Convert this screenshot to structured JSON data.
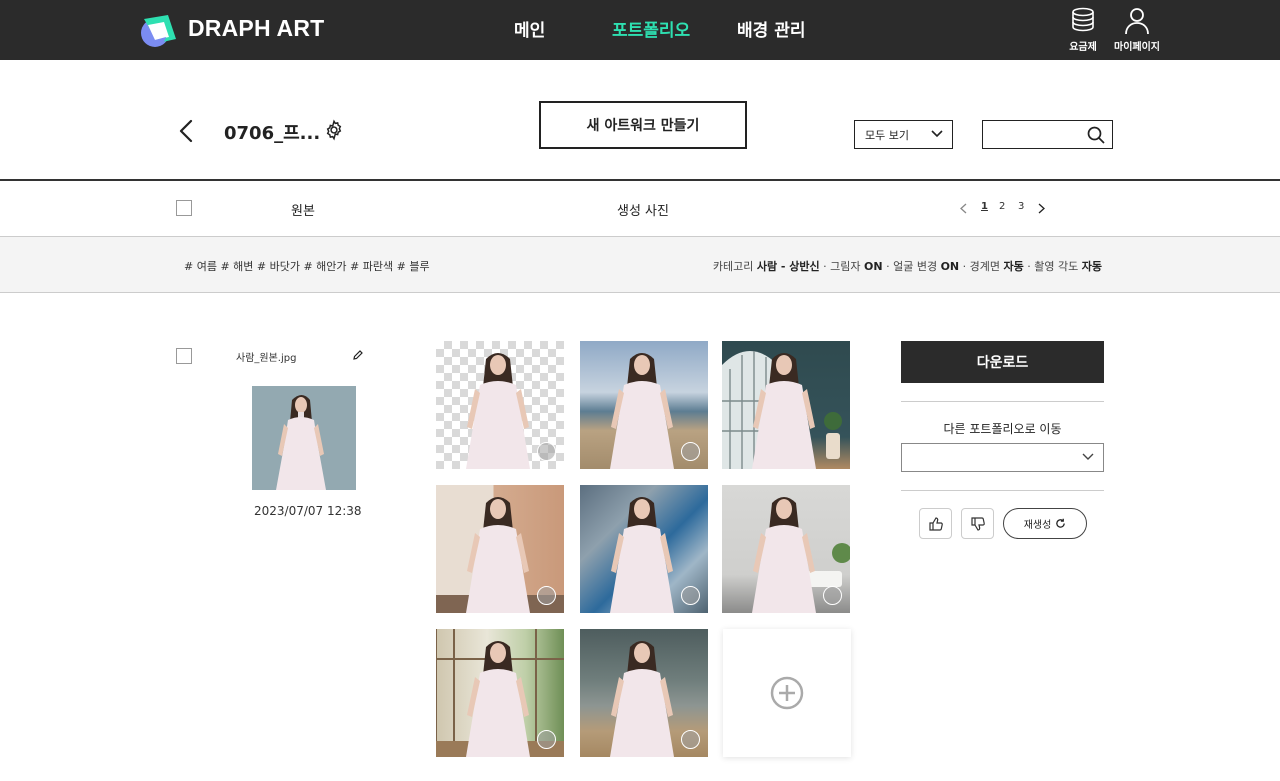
{
  "topbar": {
    "brand": "DRAPH ART",
    "nav": [
      "메인",
      "포트폴리오",
      "배경 관리"
    ],
    "active_nav": "포트폴리오",
    "accent_color": "#2ee0b1",
    "icons": [
      {
        "icon": "coins-icon",
        "label": "요금제"
      },
      {
        "icon": "user-icon",
        "label": "마이페이지"
      }
    ]
  },
  "header": {
    "portfolio_title": "0706_프...",
    "new_artwork_label": "새 아트워크 만들기",
    "filter_value": "모두 보기",
    "search_value": ""
  },
  "columns": {
    "original": "원본",
    "generated": "생성 사진",
    "pages": [
      "1",
      "2",
      "3"
    ],
    "current_page": "1"
  },
  "tags": "# 여름 # 해변 # 바닷가 # 해안가 # 파란색 # 블루",
  "meta": {
    "category_label": "카테고리",
    "category_value": "사람 - 상반신",
    "shadow_label": "그림자",
    "shadow_value": "ON",
    "face_label": "얼굴 변경",
    "face_value": "ON",
    "border_label": "경계면",
    "border_value": "자동",
    "angle_label": "촬영 각도",
    "angle_value": "자동"
  },
  "original": {
    "filename": "사람_원본.jpg",
    "date": "2023/07/07 12:38"
  },
  "generated_images": [
    {
      "background": "transparent-checker"
    },
    {
      "background": "beach-sky"
    },
    {
      "background": "dark-teal-room-arched-window"
    },
    {
      "background": "beige-arch-wall"
    },
    {
      "background": "blurred-blue-coast"
    },
    {
      "background": "white-bathroom"
    },
    {
      "background": "sunlit-interior-window"
    },
    {
      "background": "ocean-shore"
    }
  ],
  "actions": {
    "download_label": "다운로드",
    "move_label": "다른 포트폴리오로 이동",
    "move_value": "",
    "regen_label": "재생성"
  }
}
